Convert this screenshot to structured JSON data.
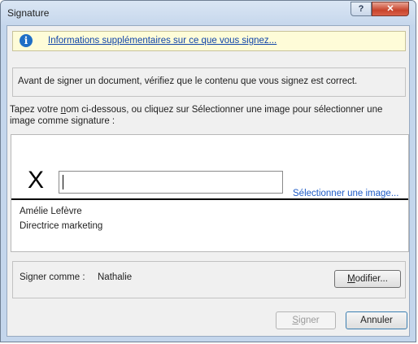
{
  "window": {
    "title": "Signature",
    "help_glyph": "?",
    "close_glyph": "✕"
  },
  "info": {
    "icon": "info-icon",
    "link_text": "Informations supplémentaires sur ce que vous signez..."
  },
  "verify_text": "Avant de signer un document, vérifiez que le contenu que vous signez est correct.",
  "instructions": {
    "part1": "Tapez votre ",
    "underlined": "n",
    "part2": "om ci-dessous, ou cliquez sur Sélectionner une image pour sélectionner une image comme signature :"
  },
  "signature": {
    "x_mark": "X",
    "input_value": "",
    "select_image_link": "Sélectionner une image...",
    "signer_name": "Amélie Lefèvre",
    "signer_title": "Directrice marketing"
  },
  "sign_as": {
    "label": "Signer comme :",
    "value": "Nathalie",
    "modify_button_accel": "M",
    "modify_button_rest": "odifier..."
  },
  "buttons": {
    "sign_accel": "S",
    "sign_rest": "igner",
    "cancel": "Annuler"
  },
  "colors": {
    "accent_link": "#0f44a9",
    "info_bar_bg": "#fefcd8",
    "close_button": "#c8442c"
  }
}
